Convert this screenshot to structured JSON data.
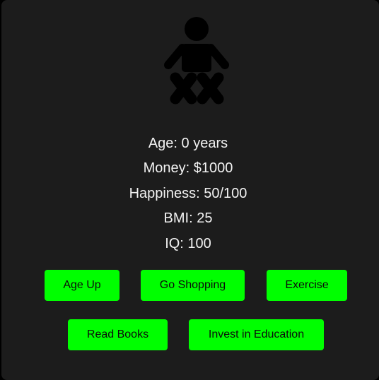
{
  "character": {
    "icon": "baby-icon"
  },
  "stats": {
    "age": "Age: 0 years",
    "money": "Money: $1000",
    "happiness": "Happiness: 50/100",
    "bmi": "BMI: 25",
    "iq": "IQ: 100"
  },
  "actions": {
    "age_up": "Age Up",
    "go_shopping": "Go Shopping",
    "exercise": "Exercise",
    "read_books": "Read Books",
    "invest_education": "Invest in Education"
  },
  "colors": {
    "background": "#1c1c1c",
    "button": "#00ff00",
    "text": "#f2f2f2",
    "button_text": "#0c0c0c"
  }
}
